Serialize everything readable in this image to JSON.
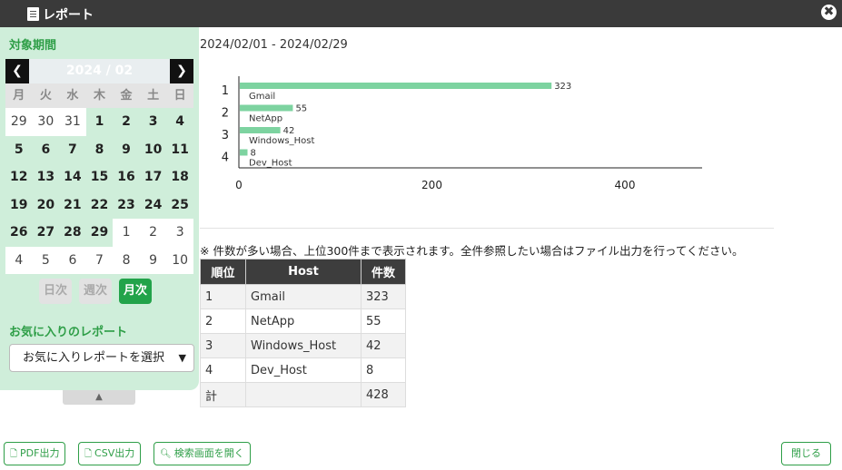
{
  "window": {
    "title": "レポート",
    "close_glyph": "✖"
  },
  "sidebar": {
    "period_label": "対象期間",
    "calendar": {
      "month": "2024 / 02",
      "prev_glyph": "❮",
      "next_glyph": "❯",
      "weekdays": [
        "月",
        "火",
        "水",
        "木",
        "金",
        "土",
        "日"
      ],
      "weeks": [
        [
          {
            "d": "29",
            "in": false
          },
          {
            "d": "30",
            "in": false
          },
          {
            "d": "31",
            "in": false
          },
          {
            "d": "1",
            "in": true
          },
          {
            "d": "2",
            "in": true
          },
          {
            "d": "3",
            "in": true
          },
          {
            "d": "4",
            "in": true
          }
        ],
        [
          {
            "d": "5",
            "in": true
          },
          {
            "d": "6",
            "in": true
          },
          {
            "d": "7",
            "in": true
          },
          {
            "d": "8",
            "in": true
          },
          {
            "d": "9",
            "in": true
          },
          {
            "d": "10",
            "in": true
          },
          {
            "d": "11",
            "in": true
          }
        ],
        [
          {
            "d": "12",
            "in": true
          },
          {
            "d": "13",
            "in": true
          },
          {
            "d": "14",
            "in": true
          },
          {
            "d": "15",
            "in": true
          },
          {
            "d": "16",
            "in": true
          },
          {
            "d": "17",
            "in": true
          },
          {
            "d": "18",
            "in": true
          }
        ],
        [
          {
            "d": "19",
            "in": true
          },
          {
            "d": "20",
            "in": true
          },
          {
            "d": "21",
            "in": true
          },
          {
            "d": "22",
            "in": true
          },
          {
            "d": "23",
            "in": true
          },
          {
            "d": "24",
            "in": true
          },
          {
            "d": "25",
            "in": true
          }
        ],
        [
          {
            "d": "26",
            "in": true
          },
          {
            "d": "27",
            "in": true
          },
          {
            "d": "28",
            "in": true
          },
          {
            "d": "29",
            "in": true
          },
          {
            "d": "1",
            "in": false
          },
          {
            "d": "2",
            "in": false
          },
          {
            "d": "3",
            "in": false
          }
        ],
        [
          {
            "d": "4",
            "in": false
          },
          {
            "d": "5",
            "in": false
          },
          {
            "d": "6",
            "in": false
          },
          {
            "d": "7",
            "in": false
          },
          {
            "d": "8",
            "in": false
          },
          {
            "d": "9",
            "in": false
          },
          {
            "d": "10",
            "in": false
          }
        ]
      ]
    },
    "modes": [
      {
        "label": "日次",
        "active": false
      },
      {
        "label": "週次",
        "active": false
      },
      {
        "label": "月次",
        "active": true
      }
    ],
    "favorites_label": "お気に入りのレポート",
    "favorites_select": "お気に入りレポートを選択",
    "collapse_glyph": "▲"
  },
  "main": {
    "date_range": "2024/02/01 - 2024/02/29",
    "note": "※ 件数が多い場合、上位300件まで表示されます。全件参照したい場合はファイル出力を行ってください。",
    "table": {
      "headers": [
        "順位",
        "Host",
        "件数"
      ],
      "rows": [
        [
          "1",
          "Gmail",
          "323"
        ],
        [
          "2",
          "NetApp",
          "55"
        ],
        [
          "3",
          "Windows_Host",
          "42"
        ],
        [
          "4",
          "Dev_Host",
          "8"
        ],
        [
          "計",
          "",
          "428"
        ]
      ]
    }
  },
  "chart_data": {
    "type": "bar",
    "orientation": "horizontal",
    "categories": [
      "1",
      "2",
      "3",
      "4"
    ],
    "labels": [
      "Gmail",
      "NetApp",
      "Windows_Host",
      "Dev_Host"
    ],
    "values": [
      323,
      55,
      42,
      8
    ],
    "x_ticks": [
      0,
      200,
      400
    ],
    "xlim": [
      0,
      480
    ],
    "bar_color": "#7dd3a0",
    "grid": false
  },
  "footer": {
    "pdf_label": "PDF出力",
    "csv_label": "CSV出力",
    "search_label": "検索画面を開く",
    "close_label": "閉じる"
  },
  "colors": {
    "accent": "#2e9e47",
    "titlebar": "#3a3a3a",
    "panel": "#cfeeda"
  }
}
